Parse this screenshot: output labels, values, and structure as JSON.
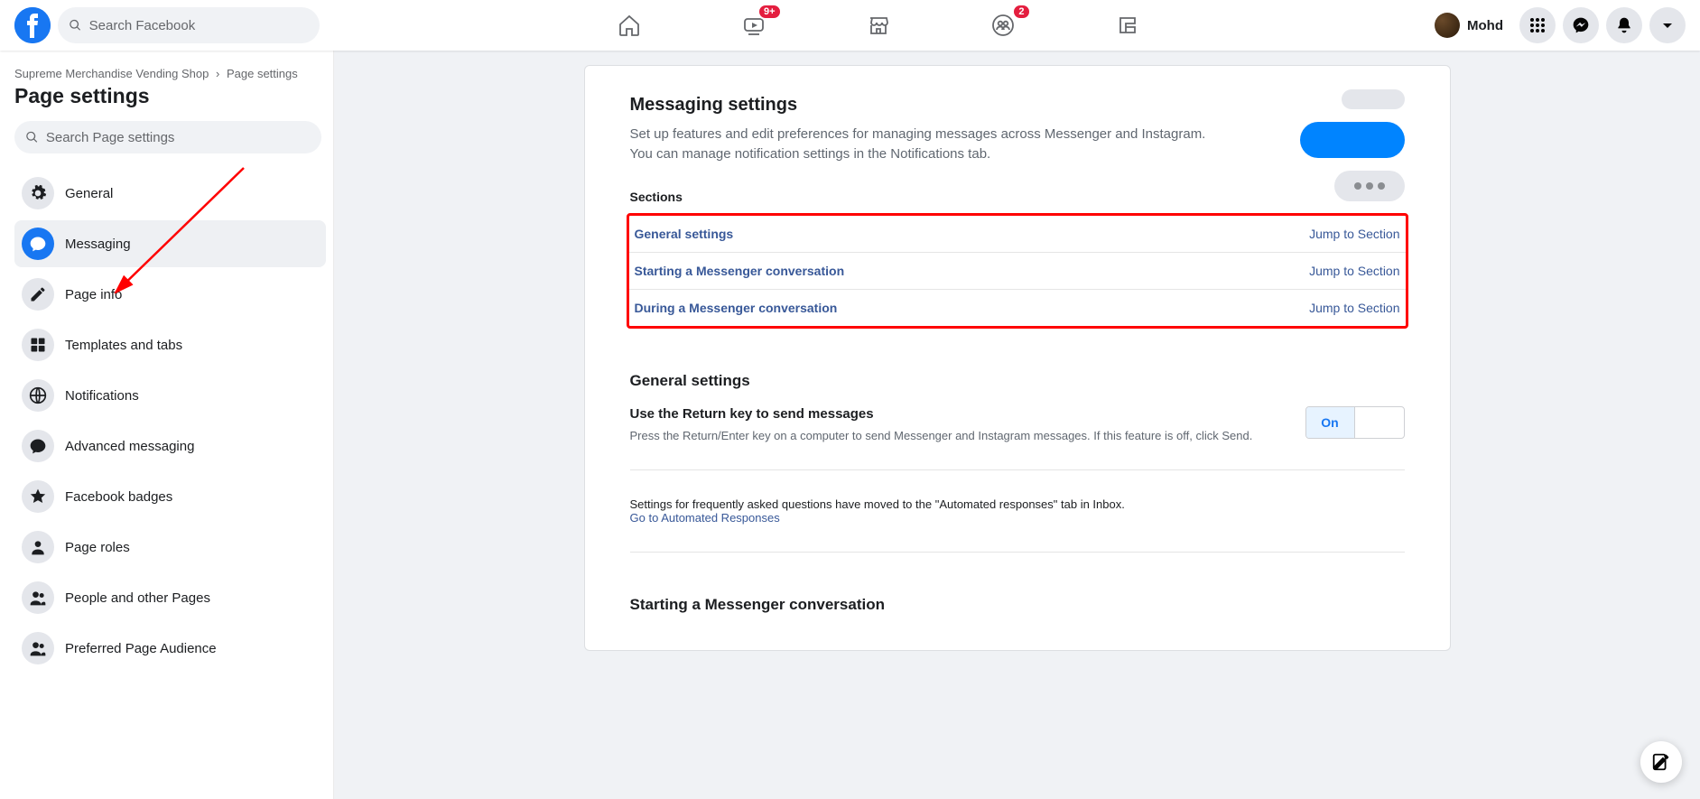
{
  "topnav": {
    "search_placeholder": "Search Facebook",
    "watch_badge": "9+",
    "groups_badge": "2",
    "user_name": "Mohd"
  },
  "sidebar": {
    "breadcrumb_page": "Supreme Merchandise Vending Shop",
    "breadcrumb_sep": "›",
    "breadcrumb_current": "Page settings",
    "title": "Page settings",
    "search_placeholder": "Search Page settings",
    "items": [
      {
        "label": "General"
      },
      {
        "label": "Messaging"
      },
      {
        "label": "Page info"
      },
      {
        "label": "Templates and tabs"
      },
      {
        "label": "Notifications"
      },
      {
        "label": "Advanced messaging"
      },
      {
        "label": "Facebook badges"
      },
      {
        "label": "Page roles"
      },
      {
        "label": "People and other Pages"
      },
      {
        "label": "Preferred Page Audience"
      }
    ]
  },
  "main": {
    "heading": "Messaging settings",
    "description": "Set up features and edit preferences for managing messages across Messenger and Instagram. You can manage notification settings in the Notifications tab.",
    "sections_label": "Sections",
    "sections": [
      {
        "label": "General settings",
        "jump": "Jump to Section"
      },
      {
        "label": "Starting a Messenger conversation",
        "jump": "Jump to Section"
      },
      {
        "label": "During a Messenger conversation",
        "jump": "Jump to Section"
      }
    ],
    "general": {
      "heading": "General settings",
      "return_key_title": "Use the Return key to send messages",
      "return_key_sub": "Press the Return/Enter key on a computer to send Messenger and Instagram messages. If this feature is off, click Send.",
      "toggle_on": "On",
      "toggle_off": ""
    },
    "faq_note": "Settings for frequently asked questions have moved to the \"Automated responses\" tab in Inbox.",
    "faq_link": "Go to Automated Responses",
    "starting_heading": "Starting a Messenger conversation"
  }
}
